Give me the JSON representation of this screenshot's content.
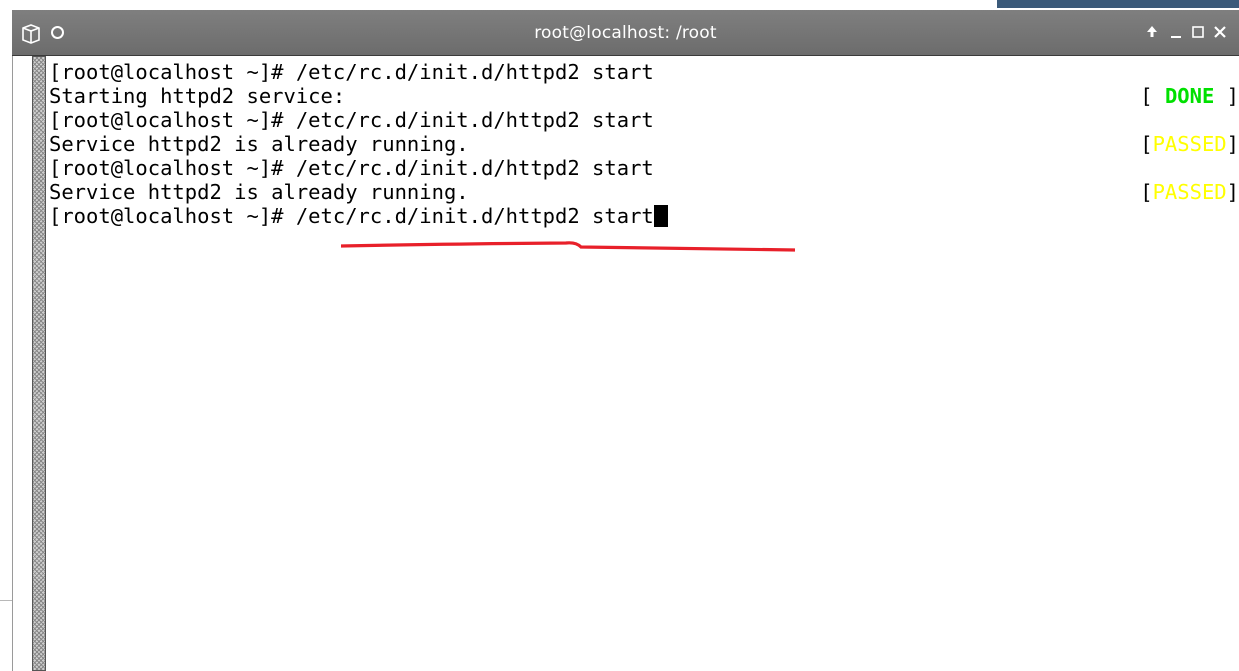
{
  "window": {
    "title": "root@localhost: /root",
    "controls": {
      "up_icon": "arrow-up-icon",
      "minimize_icon": "minimize-icon",
      "maximize_icon": "maximize-icon",
      "close_icon": "close-icon"
    }
  },
  "terminal": {
    "lines": [
      {
        "text": "[root@localhost ~]# /etc/rc.d/init.d/httpd2 start"
      },
      {
        "text": "Starting httpd2 service:",
        "status_open": "[ ",
        "status_word": "DONE",
        "status_close": " ]",
        "status_color": "#00e000"
      },
      {
        "text": "[root@localhost ~]# /etc/rc.d/init.d/httpd2 start"
      },
      {
        "text": "Service httpd2 is already running.",
        "status_open": "[",
        "status_word": "PASSED",
        "status_close": "]",
        "status_color": "#ffff00"
      },
      {
        "text": "[root@localhost ~]# /etc/rc.d/init.d/httpd2 start"
      },
      {
        "text": "Service httpd2 is already running.",
        "status_open": "[",
        "status_word": "PASSED",
        "status_close": "]",
        "status_color": "#ffff00"
      },
      {
        "prompt": "[root@localhost ~]# ",
        "command": "/etc/rc.d/init.d/httpd2 start"
      }
    ]
  },
  "colors": {
    "titlebar": "#757575",
    "annotation_red": "#e8202a",
    "done_green": "#00e000",
    "passed_yellow": "#ffff00"
  }
}
